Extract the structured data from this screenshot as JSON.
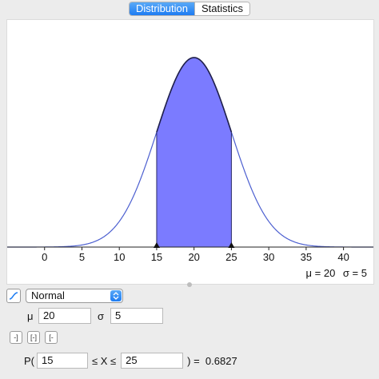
{
  "tabs": [
    {
      "label": "Distribution",
      "active": true
    },
    {
      "label": "Statistics",
      "active": false
    }
  ],
  "chart_data": {
    "type": "area",
    "distribution": "Normal",
    "mu": 20,
    "sigma": 5,
    "xlim": [
      -5,
      44
    ],
    "x_ticks": [
      "0",
      "5",
      "10",
      "15",
      "20",
      "25",
      "30",
      "35",
      "40"
    ],
    "tick_values": [
      0,
      5,
      10,
      15,
      20,
      25,
      30,
      35,
      40
    ],
    "shaded_interval": [
      15,
      25
    ],
    "curve_color": "#4c5fd0",
    "fill_color": "#7b7bff"
  },
  "readout": {
    "mu_text": "μ = 20",
    "sigma_text": "σ = 5"
  },
  "controls": {
    "distribution_select": "Normal",
    "mu_label": "μ",
    "mu_value": "20",
    "sigma_label": "σ",
    "sigma_value": "5",
    "interval_buttons": [
      "-]",
      "[-]",
      "[-"
    ],
    "prob_prefix": "P(",
    "lower_value": "15",
    "middle_text": "≤ X ≤",
    "upper_value": "25",
    "result_text": ") =  0.6827"
  },
  "colors": {
    "accent": "#1e7cf2"
  }
}
